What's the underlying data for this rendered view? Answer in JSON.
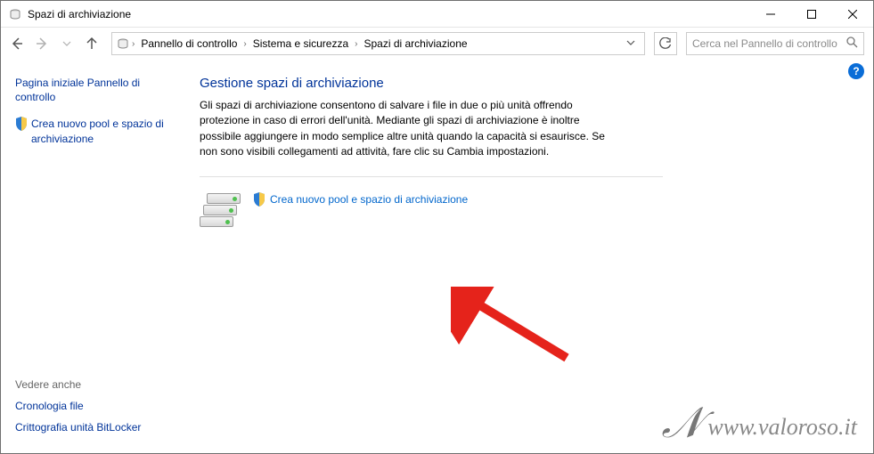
{
  "window": {
    "title": "Spazi di archiviazione"
  },
  "breadcrumb": {
    "items": [
      "Pannello di controllo",
      "Sistema e sicurezza",
      "Spazi di archiviazione"
    ]
  },
  "search": {
    "placeholder": "Cerca nel Pannello di controllo"
  },
  "sidebar": {
    "link_home": "Pagina iniziale Pannello di controllo",
    "link_create": "Crea nuovo pool e spazio di archiviazione",
    "see_also_title": "Vedere anche",
    "see_also": {
      "history": "Cronologia file",
      "bitlocker": "Crittografia unità BitLocker"
    }
  },
  "main": {
    "heading": "Gestione spazi di archiviazione",
    "description": "Gli spazi di archiviazione consentono di salvare i file in due o più unità offrendo protezione in caso di errori dell'unità. Mediante gli spazi di archiviazione è inoltre possibile aggiungere in modo semplice altre unità quando la capacità si esaurisce. Se non sono visibili collegamenti ad attività, fare clic su Cambia impostazioni.",
    "action_link": "Crea nuovo pool e spazio di archiviazione"
  },
  "watermark": {
    "text": "www.valoroso.it"
  },
  "help_icon_label": "?"
}
